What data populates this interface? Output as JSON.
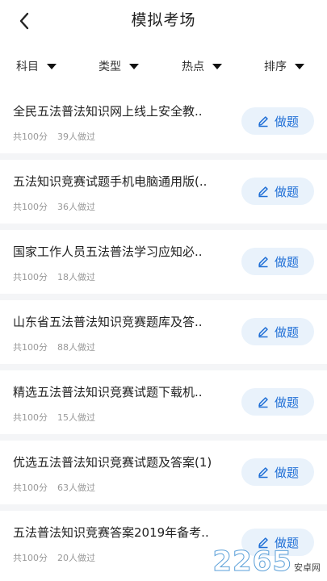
{
  "header": {
    "title": "模拟考场",
    "back_icon": "chevron-left-icon"
  },
  "filters": [
    {
      "label": "科目"
    },
    {
      "label": "类型"
    },
    {
      "label": "热点"
    },
    {
      "label": "排序"
    }
  ],
  "items": [
    {
      "title": "全民五法普法知识网上线上安全教..",
      "total": "共100分",
      "count": "39人做过",
      "button": "做题"
    },
    {
      "title": "五法知识竞赛试题手机电脑通用版(..",
      "total": "共100分",
      "count": "36人做过",
      "button": "做题"
    },
    {
      "title": "国家工作人员五法普法学习应知必..",
      "total": "共100分",
      "count": "18人做过",
      "button": "做题"
    },
    {
      "title": "山东省五法普法知识竞赛题库及答..",
      "total": "共100分",
      "count": "88人做过",
      "button": "做题"
    },
    {
      "title": "精选五法普法知识竞赛试题下载机..",
      "total": "共100分",
      "count": "15人做过",
      "button": "做题"
    },
    {
      "title": "优选五法普法知识竞赛试题及答案(1)",
      "total": "共100分",
      "count": "63人做过",
      "button": "做题"
    },
    {
      "title": "五法普法知识竞赛答案2019年备考..",
      "total": "共100分",
      "count": "20人做过",
      "button": "做题"
    }
  ],
  "watermark": {
    "number": "2265",
    "suffix": "安卓网"
  },
  "colors": {
    "accent": "#1f6fd6",
    "button_bg": "#e9f2fb",
    "band": "#f4f5f7"
  }
}
